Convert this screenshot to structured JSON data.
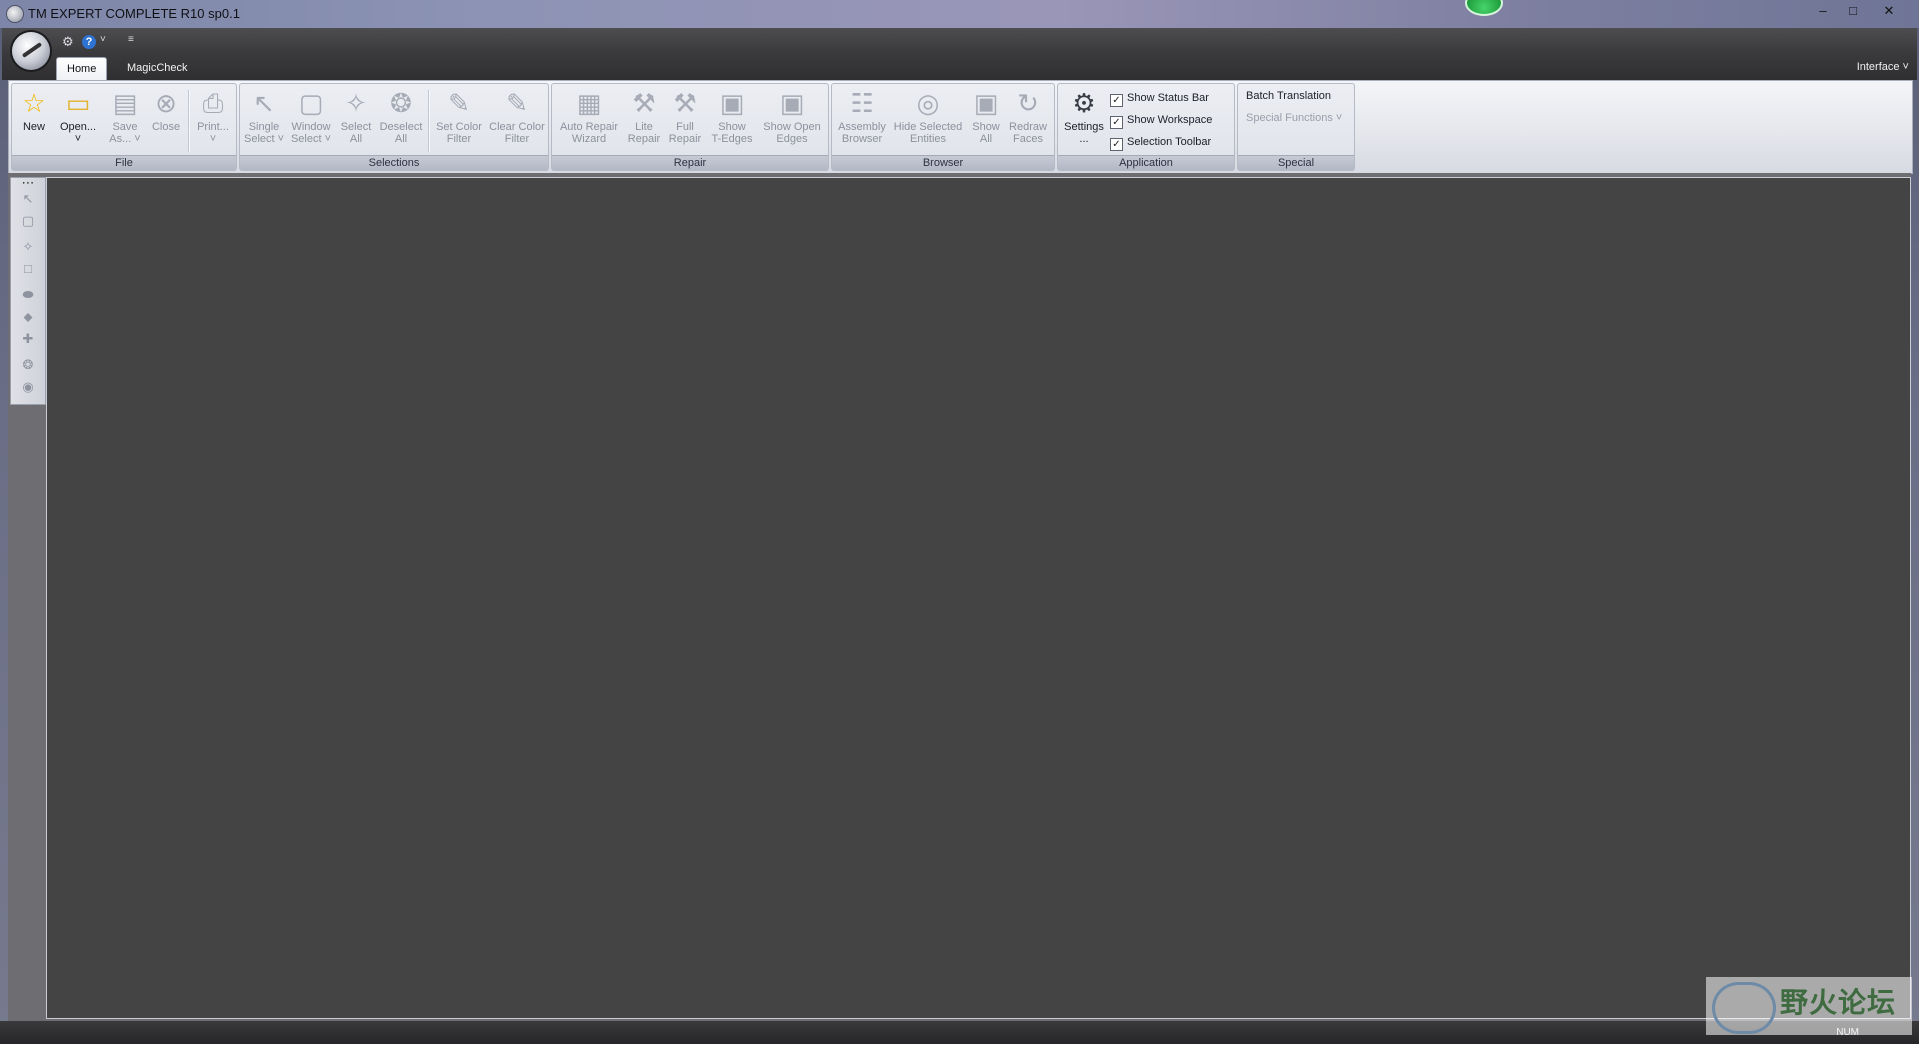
{
  "window": {
    "title": "TM EXPERT COMPLETE R10 sp0.1",
    "controls": {
      "minimize": "–",
      "maximize": "□",
      "close": "✕"
    }
  },
  "quick_access": {
    "settings_icon": "⚙",
    "help_icon": "?",
    "help_dropdown": "˅",
    "customize": "≡"
  },
  "tabs": [
    {
      "label": "Home",
      "active": true
    },
    {
      "label": "MagicCheck",
      "active": false
    }
  ],
  "interface_menu": "Interface ˅",
  "ribbon": {
    "file": {
      "label": "File",
      "new": "New",
      "open": "Open...\n˅",
      "save_as": "Save\nAs... ˅",
      "close": "Close",
      "print": "Print...\n˅"
    },
    "selections": {
      "label": "Selections",
      "single_select": "Single\nSelect ˅",
      "window_select": "Window\nSelect ˅",
      "select_all": "Select\nAll",
      "deselect_all": "Deselect\nAll",
      "set_color_filter": "Set Color\nFilter",
      "clear_color_filter": "Clear Color\nFilter"
    },
    "repair": {
      "label": "Repair",
      "auto_repair_wizard": "Auto Repair\nWizard",
      "lite_repair": "Lite\nRepair",
      "full_repair": "Full\nRepair",
      "show_t_edges": "Show\nT-Edges",
      "show_open_edges": "Show Open\nEdges"
    },
    "browser": {
      "label": "Browser",
      "assembly_browser": "Assembly\nBrowser",
      "hide_selected_entities": "Hide Selected\nEntities",
      "show_all": "Show\nAll",
      "redraw_faces": "Redraw\nFaces"
    },
    "application": {
      "label": "Application",
      "settings": "Settings\n...",
      "show_status_bar": "Show Status Bar",
      "show_workspace": "Show Workspace",
      "selection_toolbar": "Selection Toolbar",
      "checked_mark": "✓"
    },
    "special": {
      "label": "Special",
      "batch_translation": "Batch Translation",
      "special_functions": "Special Functions  ˅"
    }
  },
  "icons": {
    "new": "☆",
    "open": "▭",
    "save_as": "▤",
    "close": "⊗",
    "print": "⎙",
    "single_select": "↖",
    "window_select": "▢",
    "select_all": "✧",
    "deselect_all": "❂",
    "set_color_filter": "✎",
    "clear_color_filter": "✎",
    "auto_repair_wizard": "▦",
    "lite_repair": "⚒",
    "full_repair": "⚒",
    "show_t_edges": "▣",
    "show_open_edges": "▣",
    "assembly_browser": "☷",
    "hide_selected_entities": "◎",
    "show_all": "▣",
    "redraw_faces": "↻",
    "settings": "⚙"
  },
  "left_toolbar": {
    "grip": "⋯",
    "select": "↖",
    "window": "▢",
    "all": "✧",
    "none": "□",
    "rotate": "⬬",
    "pan": "⬥",
    "zoom": "✚",
    "fit": "❂",
    "reset": "◉"
  },
  "status": {
    "num": "NUM"
  },
  "watermark": {
    "text": "野火论坛"
  }
}
